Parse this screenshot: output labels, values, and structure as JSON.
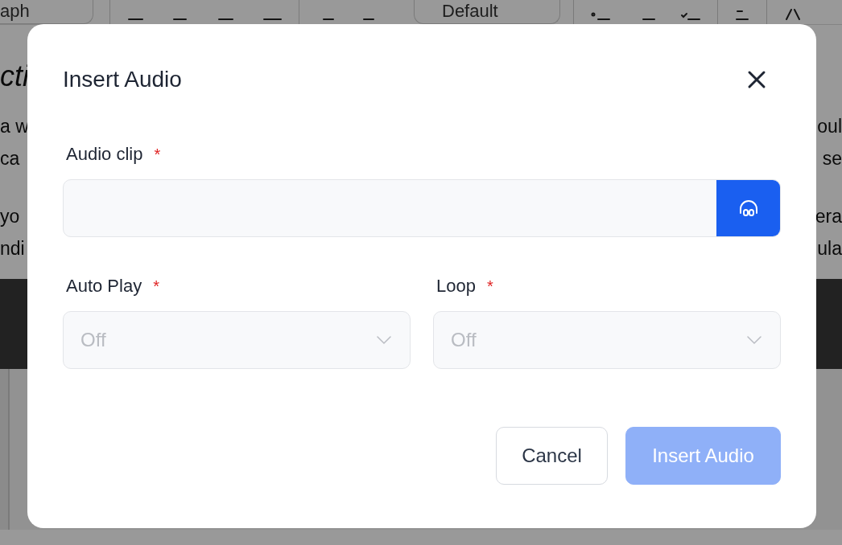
{
  "editor": {
    "toolbar": {
      "block_style": "aph",
      "font_style": "Default"
    },
    "heading": "cti",
    "lines": [
      {
        "left": "a w",
        "right": "oul"
      },
      {
        "left": "ca",
        "right": "se"
      },
      {
        "left": "yo",
        "right": "era"
      },
      {
        "left": "ndi",
        "right": "ula"
      }
    ]
  },
  "dialog": {
    "title": "Insert Audio",
    "audio_clip": {
      "label": "Audio clip",
      "required_mark": "*"
    },
    "selects": [
      {
        "label": "Auto Play",
        "required_mark": "*",
        "placeholder": "Off"
      },
      {
        "label": "Loop",
        "required_mark": "*",
        "placeholder": "Off"
      }
    ],
    "buttons": [
      {
        "label": "Cancel",
        "kind": "secondary",
        "disabled": false
      },
      {
        "label": "Insert Audio",
        "kind": "primary",
        "disabled": true
      }
    ]
  }
}
